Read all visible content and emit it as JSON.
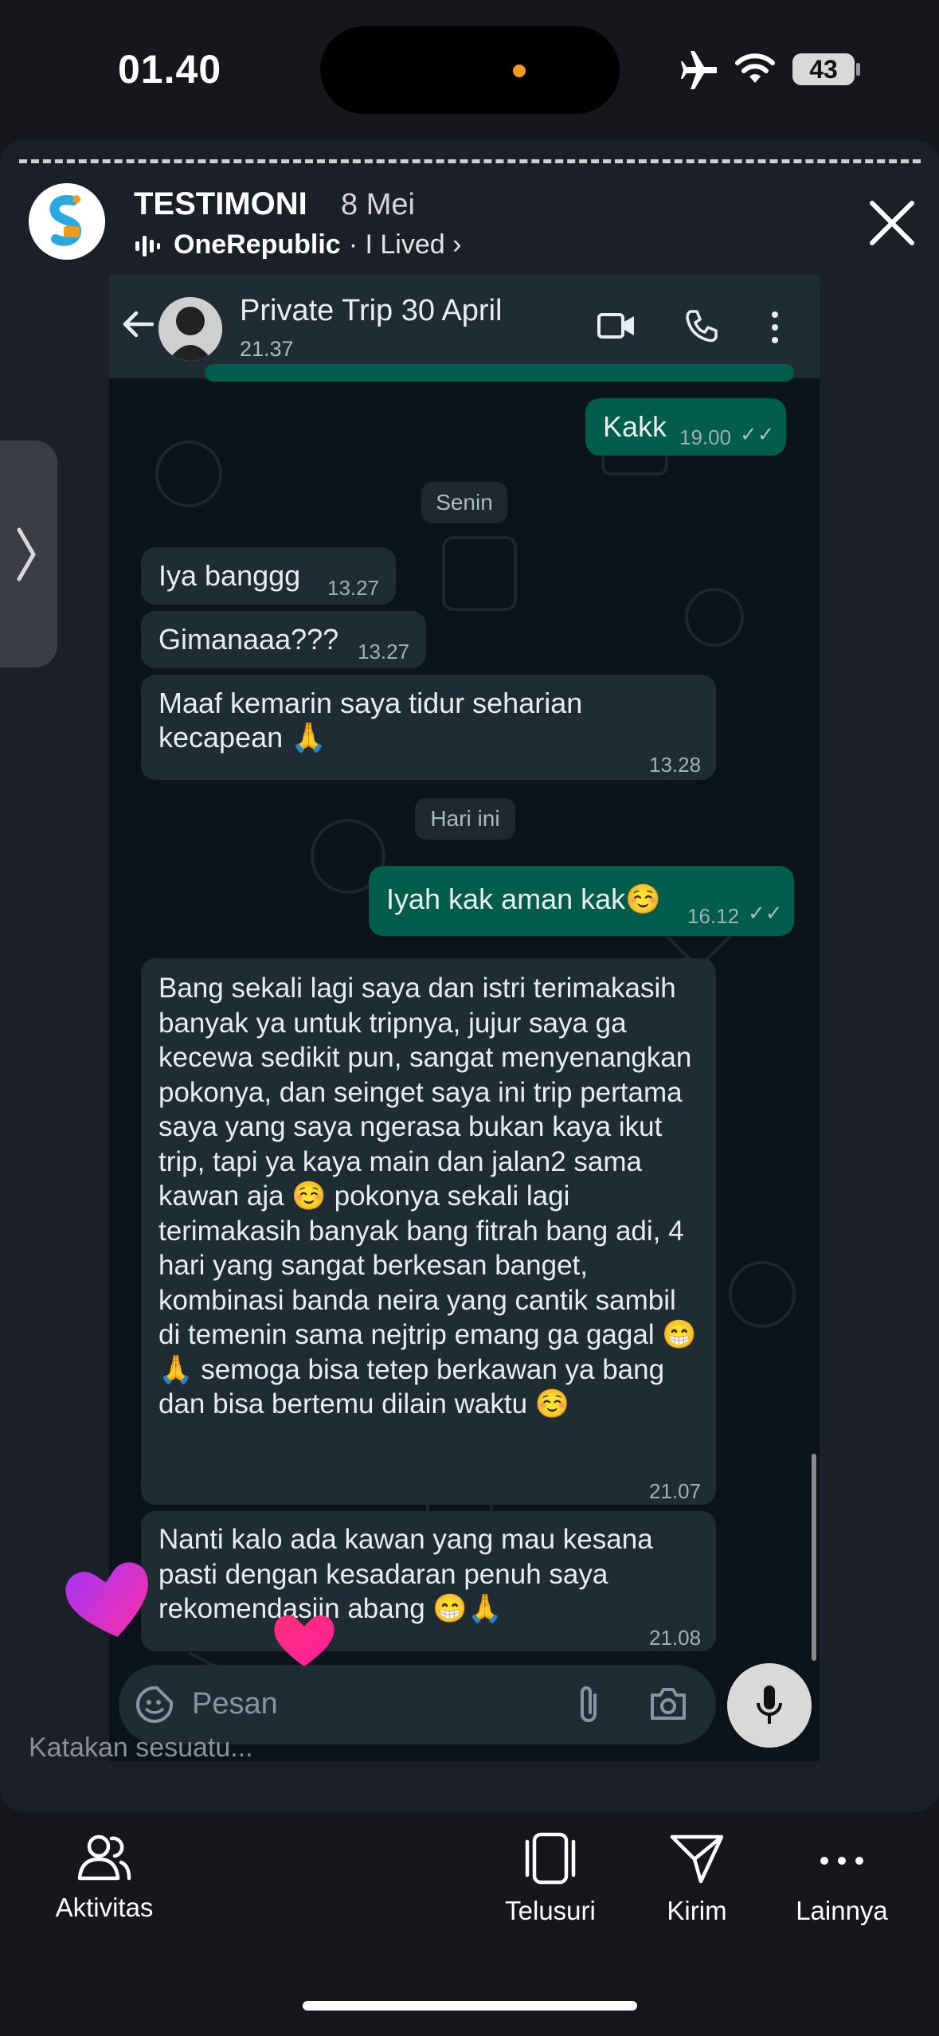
{
  "status": {
    "time": "01.40",
    "battery": "43"
  },
  "story": {
    "account": "TESTIMONI",
    "date": "8 Mei",
    "music_artist": "OneRepublic",
    "music_song": "· I Lived ›",
    "reply_placeholder": "Katakan sesuatu..."
  },
  "chat": {
    "title": "Private Trip 30 April",
    "subtitle": "21.37",
    "composer_placeholder": "Pesan",
    "day_chips": [
      "Senin",
      "Hari ini"
    ],
    "messages": [
      {
        "dir": "out",
        "text": "Kakk",
        "time": "19.00"
      },
      {
        "dir": "in",
        "text": "Iya banggg",
        "time": "13.27"
      },
      {
        "dir": "in",
        "text": "Gimanaaa???",
        "time": "13.27"
      },
      {
        "dir": "in",
        "text": "Maaf kemarin saya tidur seharian kecapean 🙏",
        "time": "13.28"
      },
      {
        "dir": "out",
        "text": "Iyah kak aman kak☺️",
        "time": "16.12"
      },
      {
        "dir": "in",
        "text": "Bang sekali lagi saya dan istri terimakasih banyak ya untuk tripnya, jujur saya ga kecewa sedikit pun, sangat menyenangkan pokonya, dan seinget saya ini trip pertama saya yang saya ngerasa bukan kaya ikut trip, tapi ya kaya main dan jalan2 sama kawan aja ☺️ pokonya sekali lagi terimakasih banyak bang fitrah bang adi, 4 hari yang sangat berkesan banget, kombinasi banda neira yang cantik sambil di temenin sama nejtrip emang ga gagal 😁🙏 semoga bisa tetep berkawan ya bang dan bisa bertemu dilain waktu ☺️",
        "time": "21.07"
      },
      {
        "dir": "in",
        "text": "Nanti kalo ada kawan yang mau kesana pasti dengan kesadaran penuh saya rekomendasiin abang 😁🙏",
        "time": "21.08"
      }
    ]
  },
  "nav": [
    {
      "label": "Aktivitas",
      "icon": "people-icon"
    },
    {
      "label": "Telusuri",
      "icon": "reels-icon"
    },
    {
      "label": "Kirim",
      "icon": "send-icon"
    },
    {
      "label": "Lainnya",
      "icon": "more-icon"
    }
  ],
  "colors": {
    "incoming": "#202c33",
    "outgoing": "#005c4b",
    "background": "#15171d"
  }
}
